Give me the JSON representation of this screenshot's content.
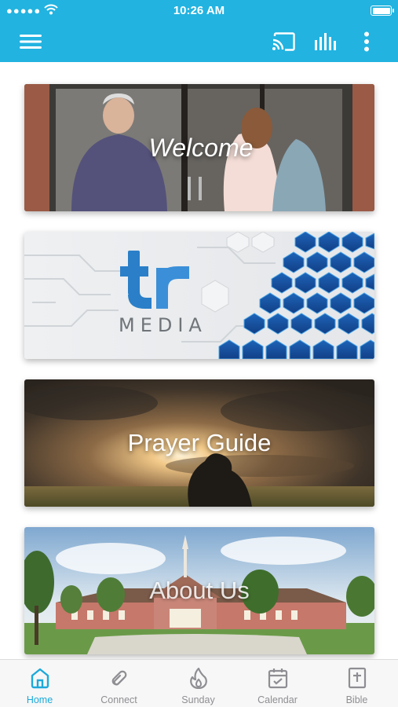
{
  "status_bar": {
    "time": "10:26 AM",
    "signal": "●●●●●"
  },
  "app_bar": {
    "icons": [
      "menu-icon",
      "cast-icon",
      "audio-icon",
      "more-vertical-icon"
    ]
  },
  "cards": {
    "welcome": "Welcome",
    "media_brand": "MEDIA",
    "prayer": "Prayer Guide",
    "about": "About Us"
  },
  "tabs": {
    "home": "Home",
    "connect": "Connect",
    "sunday": "Sunday",
    "calendar": "Calendar",
    "bible": "Bible"
  },
  "colors": {
    "brand": "#22b3e0",
    "active_tab": "#1ca9da",
    "inactive_tab": "#8e8e93"
  }
}
